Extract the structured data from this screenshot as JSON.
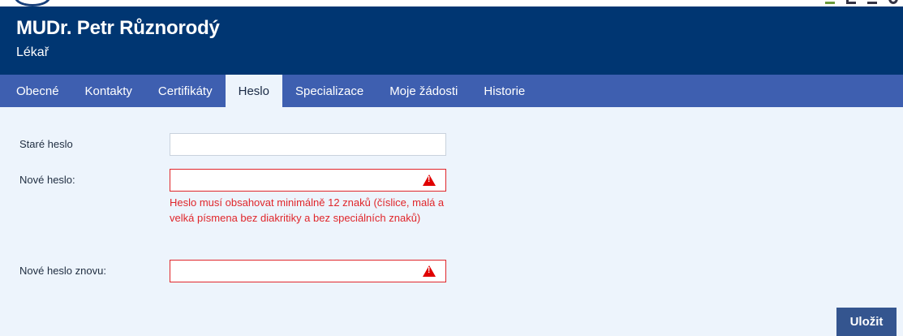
{
  "header": {
    "user_name": "MUDr. Petr Různorodý",
    "user_role": "Lékař"
  },
  "tabs": [
    {
      "label": "Obecné",
      "active": false
    },
    {
      "label": "Kontakty",
      "active": false
    },
    {
      "label": "Certifikáty",
      "active": false
    },
    {
      "label": "Heslo",
      "active": true
    },
    {
      "label": "Specializace",
      "active": false
    },
    {
      "label": "Moje žádosti",
      "active": false
    },
    {
      "label": "Historie",
      "active": false
    }
  ],
  "form": {
    "old_password": {
      "label": "Staré heslo",
      "value": ""
    },
    "new_password": {
      "label": "Nové heslo:",
      "value": "",
      "error": true
    },
    "new_password_repeat": {
      "label": "Nové heslo znovu:",
      "value": "",
      "error": true
    },
    "error_message": "Heslo musí obsahovat minimálně 12 znaků (číslice, malá a velká písmena bez diakritiky a bez speciálních znaků)"
  },
  "actions": {
    "save_label": "Uložit"
  },
  "colors": {
    "header_bg": "#003672",
    "tabs_bg": "#3e5fb0",
    "content_bg": "#edf4fc",
    "error": "#e0262b",
    "button_bg": "#34558f"
  },
  "icons": [
    "warning-icon"
  ]
}
